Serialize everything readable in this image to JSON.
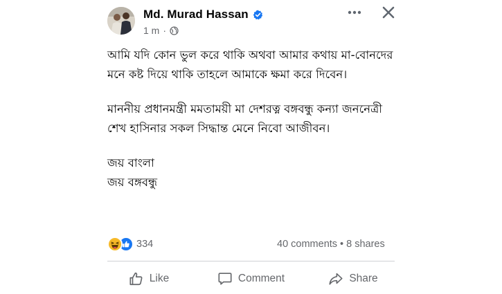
{
  "post": {
    "author": "Md. Murad Hassan",
    "time": "1 m",
    "separator": "·",
    "paragraphs": [
      "আমি যদি কোন ভুল করে থাকি অথবা আমার কথায় মা-বোনদের মনে কষ্ট দিয়ে থাকি তাহলে আমাকে ক্ষমা করে দিবেন।",
      "মাননীয় প্রধানমন্ত্রী মমতাময়ী মা দেশরত্ন বঙ্গবন্ধু কন্যা জননেত্রী শেখ হাসিনার সকল সিদ্ধান্ত মেনে নিবো আজীবন।",
      "জয় বাংলা",
      "জয় বঙ্গবন্ধু"
    ]
  },
  "reactions": {
    "count": "334",
    "icons": [
      "haha-reaction-icon",
      "like-reaction-icon"
    ]
  },
  "stats": {
    "comments": "40 comments",
    "bullet": "•",
    "shares": "8 shares"
  },
  "actions": {
    "like": "Like",
    "comment": "Comment",
    "share": "Share"
  },
  "colors": {
    "facebook_blue": "#1877f2",
    "secondary_text": "#65676b",
    "primary_text": "#050505",
    "divider": "#ced0d4",
    "haha_yellow": "#f7b928"
  }
}
